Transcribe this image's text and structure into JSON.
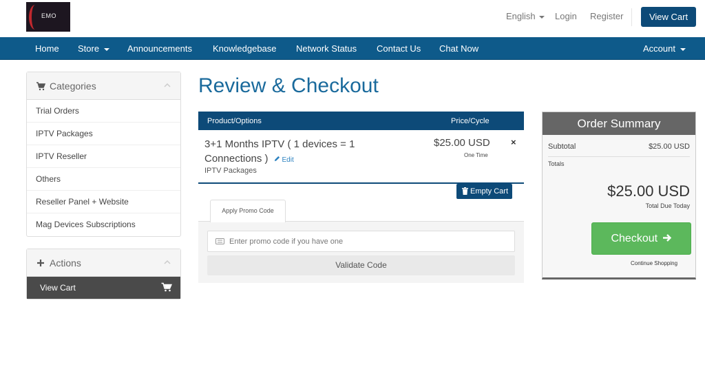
{
  "header": {
    "logo_text": "EMO",
    "language": "English",
    "login": "Login",
    "register": "Register",
    "view_cart": "View Cart"
  },
  "nav": {
    "home": "Home",
    "store": "Store",
    "announcements": "Announcements",
    "knowledgebase": "Knowledgebase",
    "network_status": "Network Status",
    "contact_us": "Contact Us",
    "chat_now": "Chat Now",
    "account": "Account"
  },
  "sidebar": {
    "categories_title": "Categories",
    "categories": [
      "Trial Orders",
      "IPTV Packages",
      "IPTV Reseller",
      "Others",
      "Reseller Panel + Website",
      "Mag Devices Subscriptions"
    ],
    "actions_title": "Actions",
    "actions": [
      "View Cart"
    ]
  },
  "main": {
    "title": "Review & Checkout",
    "table": {
      "col_product": "Product/Options",
      "col_price": "Price/Cycle"
    },
    "item": {
      "name": "3+1 Months IPTV ( 1 devices = 1 Connections )",
      "edit": "Edit",
      "group": "IPTV Packages",
      "price": "$25.00 USD",
      "cycle": "One Time",
      "remove": "×"
    },
    "empty_cart": "Empty Cart",
    "promo": {
      "tab": "Apply Promo Code",
      "placeholder": "Enter promo code if you have one",
      "validate": "Validate Code"
    }
  },
  "summary": {
    "title": "Order Summary",
    "subtotal_label": "Subtotal",
    "subtotal_value": "$25.00 USD",
    "totals_label": "Totals",
    "total_value": "$25.00 USD",
    "total_due": "Total Due Today",
    "checkout": "Checkout",
    "continue": "Continue Shopping"
  },
  "colors": {
    "brand_blue": "#0d4a78",
    "nav_blue": "#0e5a8a",
    "title_blue": "#1a6a9c",
    "checkout_green": "#5cb85c",
    "summary_gray": "#666666"
  }
}
